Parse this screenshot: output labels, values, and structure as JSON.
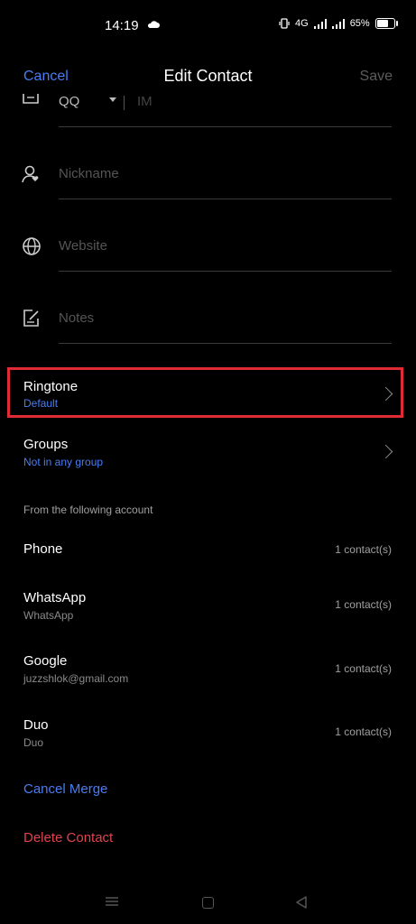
{
  "status": {
    "time": "14:19",
    "battery": "65%",
    "signal_text": "4G"
  },
  "header": {
    "cancel": "Cancel",
    "title": "Edit Contact",
    "save": "Save"
  },
  "im": {
    "type": "QQ",
    "placeholder": "IM"
  },
  "fields": [
    {
      "placeholder": "Nickname",
      "icon": "nickname-icon"
    },
    {
      "placeholder": "Website",
      "icon": "globe-icon"
    },
    {
      "placeholder": "Notes",
      "icon": "notes-icon"
    }
  ],
  "ringtone": {
    "title": "Ringtone",
    "value": "Default"
  },
  "groups": {
    "title": "Groups",
    "value": "Not in any group"
  },
  "accounts_header": "From the following account",
  "accounts": [
    {
      "name": "Phone",
      "sub": "",
      "count": "1 contact(s)"
    },
    {
      "name": "WhatsApp",
      "sub": "WhatsApp",
      "count": "1 contact(s)"
    },
    {
      "name": "Google",
      "sub": "juzzshlok@gmail.com",
      "count": "1 contact(s)"
    },
    {
      "name": "Duo",
      "sub": "Duo",
      "count": "1 contact(s)"
    }
  ],
  "actions": {
    "cancel_merge": "Cancel Merge",
    "delete": "Delete Contact"
  },
  "colors": {
    "accent": "#4a7cf3",
    "danger": "#e0434d",
    "highlight": "#e02a36"
  }
}
